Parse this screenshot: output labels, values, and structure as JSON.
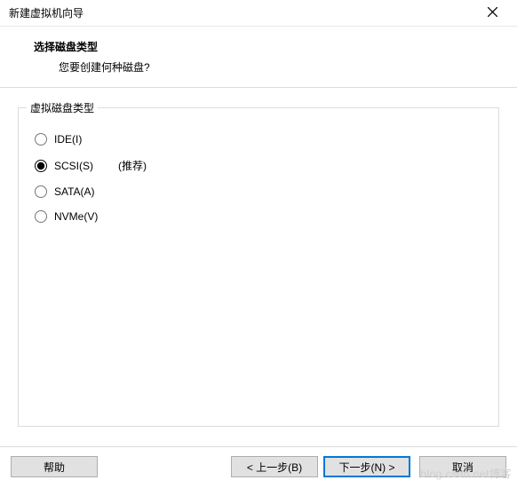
{
  "window": {
    "title": "新建虚拟机向导"
  },
  "header": {
    "title": "选择磁盘类型",
    "subtitle": "您要创建何种磁盘?"
  },
  "fieldset": {
    "legend": "虚拟磁盘类型",
    "options": [
      {
        "label": "IDE(I)",
        "recommended": "",
        "checked": false
      },
      {
        "label": "SCSI(S)",
        "recommended": "(推荐)",
        "checked": true
      },
      {
        "label": "SATA(A)",
        "recommended": "",
        "checked": false
      },
      {
        "label": "NVMe(V)",
        "recommended": "",
        "checked": false
      }
    ]
  },
  "footer": {
    "help": "帮助",
    "back": "< 上一步(B)",
    "next": "下一步(N) >",
    "cancel": "取消"
  },
  "watermark": "blog.csdn.net博客"
}
